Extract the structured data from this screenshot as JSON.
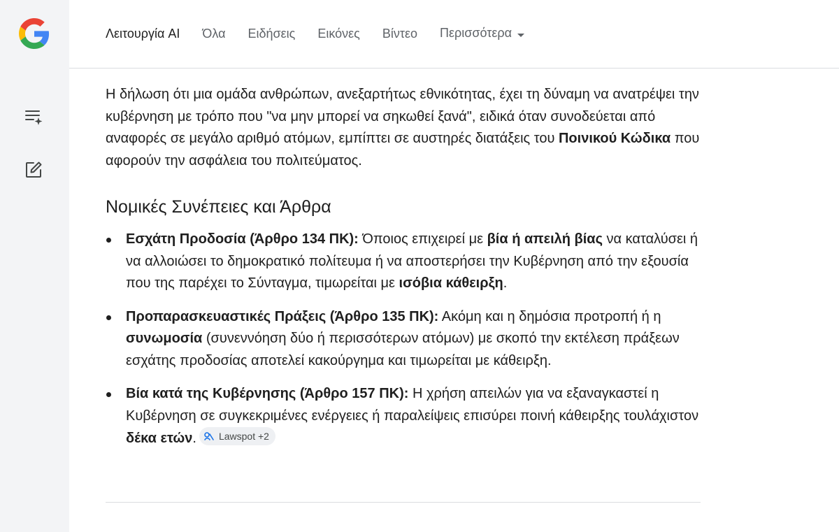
{
  "colors": {
    "sidebar_bg": "#f3f4f6",
    "text": "#1f1f1f",
    "muted_text": "#5f6368",
    "chip_bg": "#eef0f3",
    "divider": "#dadce0"
  },
  "sidebar": {
    "logo": "google-g-logo",
    "buttons": [
      {
        "icon": "history-sparkle-icon"
      },
      {
        "icon": "new-chat-edit-icon"
      }
    ]
  },
  "tabs": [
    {
      "label": "Λειτουργία AI",
      "active": true
    },
    {
      "label": "Όλα"
    },
    {
      "label": "Ειδήσεις"
    },
    {
      "label": "Εικόνες"
    },
    {
      "label": "Βίντεο"
    },
    {
      "label": "Περισσότερα",
      "has_dropdown": true
    }
  ],
  "content": {
    "intro": {
      "part1": "Η δήλωση ότι μια ομάδα ανθρώπων, ανεξαρτήτως εθνικότητας, έχει τη δύναμη να ανατρέψει την κυβέρνηση με τρόπο που \"να μην μπορεί να σηκωθεί ξανά\", ειδικά όταν συνοδεύεται από αναφορές σε μεγάλο αριθμό ατόμων, εμπίπτει σε αυστηρές διατάξεις του ",
      "bold": "Ποινικού Κώδικα",
      "part2": " που αφορούν την ασφάλεια του πολιτεύματος."
    },
    "heading": "Νομικές Συνέπειες και Άρθρα",
    "items": [
      {
        "title": "Εσχάτη Προδοσία (Άρθρο 134 ΠΚ):",
        "text1": " Όποιος επιχειρεί με ",
        "bold1": "βία ή απειλή βίας",
        "text2": " να καταλύσει ή να αλλοιώσει το δημοκρατικό πολίτευμα ή να αποστερήσει την Κυβέρνηση από την εξουσία που της παρέχει το Σύνταγμα, τιμωρείται με ",
        "bold2": "ισόβια κάθειρξη",
        "text3": "."
      },
      {
        "title": "Προπαρασκευαστικές Πράξεις (Άρθρο 135 ΠΚ):",
        "text1": " Ακόμη και η δημόσια προτροπή ή η ",
        "bold1": "συνωμοσία",
        "text2": " (συνεννόηση δύο ή περισσότερων ατόμων) με σκοπό την εκτέλεση πράξεων εσχάτης προδοσίας αποτελεί κακούργημα και τιμωρείται με κάθειρξη."
      },
      {
        "title": "Βία κατά της Κυβέρνησης (Άρθρο 157 ΠΚ):",
        "text1": " Η χρήση απειλών για να εξαναγκαστεί η Κυβέρνηση σε συγκεκριμένες ενέργειες ή παραλείψεις επισύρει ποινή κάθειρξης τουλάχιστον ",
        "bold1": "δέκα ετών",
        "text2": ".",
        "source_chip": "Lawspot +2"
      }
    ]
  }
}
